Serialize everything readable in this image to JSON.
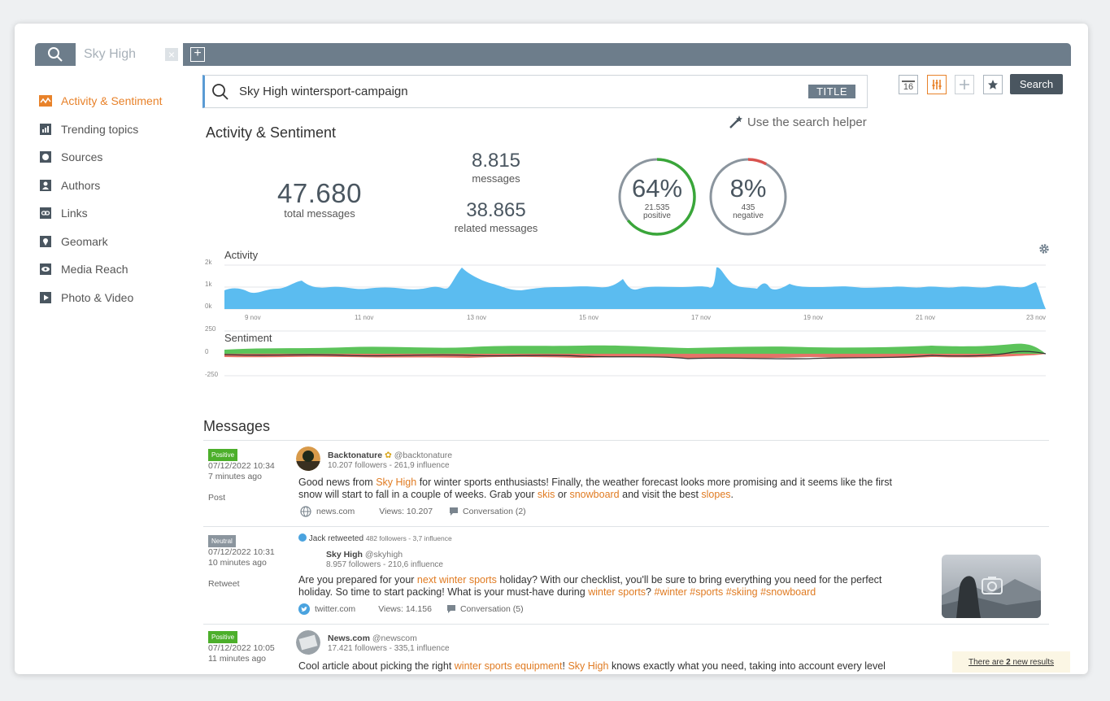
{
  "tabs": {
    "active_label": "Sky High",
    "close_label": "×",
    "add_label": "+"
  },
  "sidebar": {
    "items": [
      {
        "label": "Activity & Sentiment",
        "icon": "activity-icon",
        "active": true
      },
      {
        "label": "Trending topics",
        "icon": "bar-chart-icon"
      },
      {
        "label": "Sources",
        "icon": "sources-icon"
      },
      {
        "label": "Authors",
        "icon": "person-icon"
      },
      {
        "label": "Links",
        "icon": "link-icon"
      },
      {
        "label": "Geomark",
        "icon": "map-pin-icon"
      },
      {
        "label": "Media Reach",
        "icon": "eye-icon"
      },
      {
        "label": "Photo & Video",
        "icon": "play-icon"
      }
    ]
  },
  "search": {
    "query": "Sky High wintersport-campaign",
    "title_badge": "TITLE"
  },
  "toolbar": {
    "calendar_label": "16",
    "search_label": "Search"
  },
  "helper": {
    "label": "Use the search helper"
  },
  "section": {
    "title": "Activity & Sentiment"
  },
  "stats": {
    "total": {
      "value": "47.680",
      "label": "total messages"
    },
    "messages": {
      "value": "8.815",
      "label": "messages"
    },
    "related": {
      "value": "38.865",
      "label": "related messages"
    },
    "positive": {
      "pct": "64%",
      "count": "21.535",
      "label": "positive",
      "fraction": 0.64,
      "color": "#3aa63a"
    },
    "negative": {
      "pct": "8%",
      "count": "435",
      "label": "negative",
      "fraction": 0.08,
      "color": "#d9534f"
    }
  },
  "activity_chart": {
    "title": "Activity",
    "y_ticks": [
      "2k",
      "1k",
      "0k"
    ],
    "x_ticks": [
      "9 nov",
      "11 nov",
      "13 nov",
      "15 nov",
      "17 nov",
      "19 nov",
      "21 nov",
      "23 nov"
    ],
    "fill": "#5bbcf0"
  },
  "sentiment_chart": {
    "title": "Sentiment",
    "y_ticks": [
      "250",
      "0",
      "-250"
    ],
    "positive_color": "#5cc35a",
    "negative_color": "#e57367"
  },
  "messages": {
    "title": "Messages",
    "items": [
      {
        "badge": "Positive",
        "date": "07/12/2022 10:34",
        "ago": "7 minutes ago",
        "type": "Post",
        "author": "Backtonature",
        "handle": "@backtonature",
        "stats": "10.207 followers - 261,9 influence",
        "body": [
          {
            "t": "Good news from "
          },
          {
            "t": "Sky High",
            "h": true
          },
          {
            "t": " for winter sports enthusiasts! Finally, the weather forecast looks more promising and it seems like the first snow will start to fall in a couple of weeks. Grab your "
          },
          {
            "t": "skis",
            "h": true
          },
          {
            "t": " or "
          },
          {
            "t": "snowboard",
            "h": true
          },
          {
            "t": " and visit the best "
          },
          {
            "t": "slopes",
            "h": true
          },
          {
            "t": "."
          }
        ],
        "source": "news.com",
        "views": "Views: 10.207",
        "conversation": "Conversation (2)"
      },
      {
        "badge": "Neutral",
        "date": "07/12/2022 10:31",
        "ago": "10 minutes ago",
        "type": "Retweet",
        "retweet_by": "Jack retweeted",
        "retweet_stats": "482 followers - 3,7 influence",
        "author": "Sky High",
        "handle": "@skyhigh",
        "stats": "8.957 followers - 210,6 influence",
        "body": [
          {
            "t": "Are you prepared for your "
          },
          {
            "t": "next winter sports",
            "h": true
          },
          {
            "t": " holiday? With our checklist, you'll be sure to bring everything you need for the perfect holiday. So time to start packing! What is your must-have during "
          },
          {
            "t": "winter sports",
            "h": true
          },
          {
            "t": "? "
          },
          {
            "t": "#winter #sports #skiing #snowboard",
            "h": true
          }
        ],
        "source": "twitter.com",
        "views": "Views: 14.156",
        "conversation": "Conversation (5)"
      },
      {
        "badge": "Positive",
        "date": "07/12/2022 10:05",
        "ago": "11 minutes ago",
        "author": "News.com",
        "handle": "@newscom",
        "stats": "17.421 followers - 335,1 influence",
        "body": [
          {
            "t": "Cool article about picking the right "
          },
          {
            "t": "winter sports equipment",
            "h": true
          },
          {
            "t": "! "
          },
          {
            "t": "Sky High",
            "h": true
          },
          {
            "t": " knows exactly what you need, taking into account every level"
          }
        ]
      }
    ]
  },
  "new_results": {
    "prefix": "There are ",
    "count": "2",
    "suffix": " new results"
  }
}
